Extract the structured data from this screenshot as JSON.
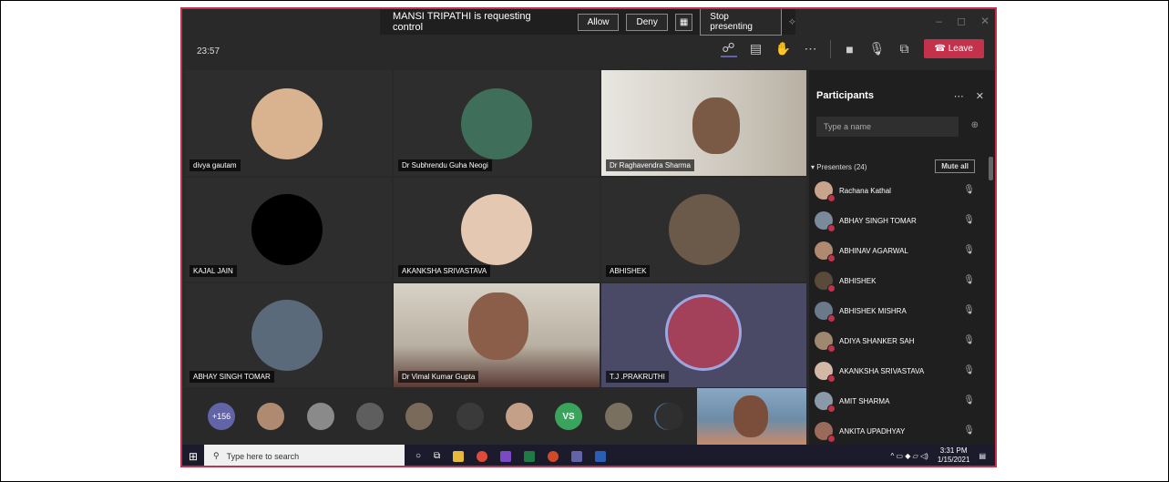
{
  "request_bar": {
    "message": "MANSI TRIPATHI is requesting control",
    "allow": "Allow",
    "deny": "Deny",
    "stop": "Stop presenting"
  },
  "toolbar": {
    "timer": "23:57",
    "leave": "Leave"
  },
  "tiles": [
    {
      "name": "divya gautam"
    },
    {
      "name": "Dr Subhrendu Guha Neogi"
    },
    {
      "name": "Dr Raghavendra Sharma"
    },
    {
      "name": "KAJAL JAIN"
    },
    {
      "name": "AKANKSHA SRIVASTAVA"
    },
    {
      "name": "ABHISHEK"
    },
    {
      "name": "ABHAY SINGH TOMAR"
    },
    {
      "name": "Dr Vimal Kumar Gupta"
    },
    {
      "name": "T.J .PRAKRUTHI"
    }
  ],
  "strip": {
    "more_count": "+156",
    "initials": "VS"
  },
  "panel": {
    "title": "Participants",
    "search_placeholder": "Type a name",
    "presenters_label": "Presenters (24)",
    "mute_all": "Mute all",
    "participants": [
      "Rachana Kathal",
      "ABHAY SINGH TOMAR",
      "ABHINAV AGARWAL",
      "ABHISHEK",
      "ABHISHEK MISHRA",
      "ADIYA SHANKER SAH",
      "AKANKSHA SRIVASTAVA",
      "AMIT SHARMA",
      "ANKITA UPADHYAY"
    ]
  },
  "taskbar": {
    "search": "Type here to search",
    "time": "3:31 PM",
    "date": "1/15/2021"
  },
  "colors": {
    "accent": "#c4314b",
    "teams": "#6264a7",
    "bg": "#292929"
  }
}
